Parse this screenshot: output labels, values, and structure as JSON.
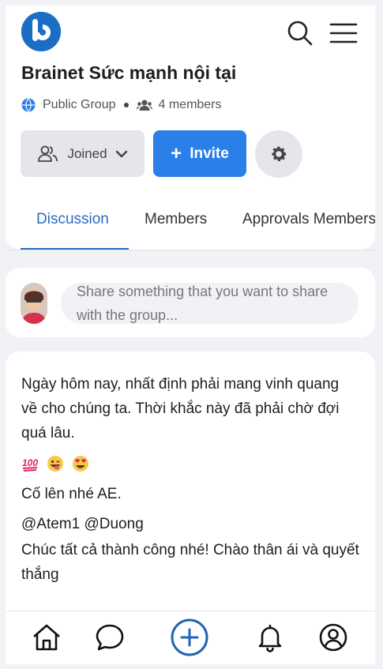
{
  "group": {
    "title": "Brainet Sức mạnh nội tại",
    "privacy": "Public Group",
    "members_count": "4 members"
  },
  "actions": {
    "joined_label": "Joined",
    "invite_label": "Invite"
  },
  "tabs": [
    {
      "label": "Discussion",
      "active": true
    },
    {
      "label": "Members",
      "active": false
    },
    {
      "label": "Approvals Members",
      "active": false
    }
  ],
  "composer": {
    "placeholder": "Share something that you want to share with the group..."
  },
  "post": {
    "paragraph": "Ngày hôm nay, nhất định phải mang vinh quang về cho chúng ta. Thời khắc này đã phải chờ đợi quá lâu.",
    "emojis": [
      "💯",
      "😜",
      "😍"
    ],
    "line_1": "Cố lên nhé AE.",
    "line_2": "@Atem1 @Duong",
    "line_3": "Chúc tất cả thành công nhé! Chào thân ái và quyết thắng"
  },
  "colors": {
    "brand": "#1a6fc4",
    "primary_button": "#2b7fe9",
    "active_tab": "#2b6cc4",
    "page_background": "#f0f2f5"
  },
  "icons": {
    "header": [
      "search-icon",
      "menu-icon"
    ],
    "bottom_nav": [
      "home-icon",
      "chat-icon",
      "create-post-icon",
      "notification-icon",
      "profile-icon"
    ]
  }
}
